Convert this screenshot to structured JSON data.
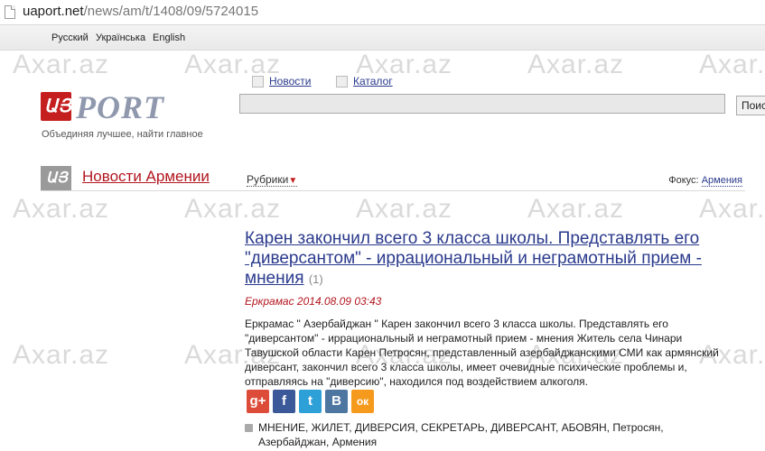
{
  "browser": {
    "url_host": "uaport.net",
    "url_path": "/news/am/t/1408/09/5724015"
  },
  "languages": [
    "Русский",
    "Українська",
    "English"
  ],
  "watermark": "Axar.az",
  "logo": {
    "text": "PORT",
    "tagline": "Объединяя лучшее, найти главное"
  },
  "topnav": {
    "news": "Новости",
    "catalog": "Каталог"
  },
  "search": {
    "button_label": "Поис"
  },
  "section": {
    "title": "Новости Армении",
    "rubrics": "Рубрики",
    "focus_label": "Фокус:",
    "focus_value": "Армения"
  },
  "article": {
    "headline": "Карен закончил всего 3 класса школы. Представлять его \"диверсантом\" - иррациональный и неграмотный прием - мнения",
    "comment_count": "(1)",
    "date": "Еркрамас 2014.08.09 03:43",
    "body": "Еркрамас \" Азербайджан \" Карен закончил всего 3 класса школы. Представлять его \"диверсантом\" - иррациональный и неграмотный прием - мнения Житель села Чинари Тавушской области Карен Петросян, представленный азербайджанскими СМИ как армянский диверсант, закончил всего 3 класса школы, имеет очевидные психические проблемы и, отправляясь на \"диверсию\", находился под воздействием алкоголя.",
    "tags": "МНЕНИЕ, ЖИЛЕТ, ДИВЕРСИЯ, СЕКРЕТАРЬ, ДИВЕРСАНТ, АБОВЯН, Петросян, Азербайджан, Армения"
  },
  "share": [
    {
      "name": "google-plus",
      "label": "g+",
      "color": "#dd4b39"
    },
    {
      "name": "facebook",
      "label": "f",
      "color": "#3b5998"
    },
    {
      "name": "twitter",
      "label": "t",
      "color": "#2ea0d8"
    },
    {
      "name": "vkontakte",
      "label": "B",
      "color": "#4d76a1"
    },
    {
      "name": "odnoklassniki",
      "label": "ок",
      "color": "#f59a1c"
    }
  ]
}
